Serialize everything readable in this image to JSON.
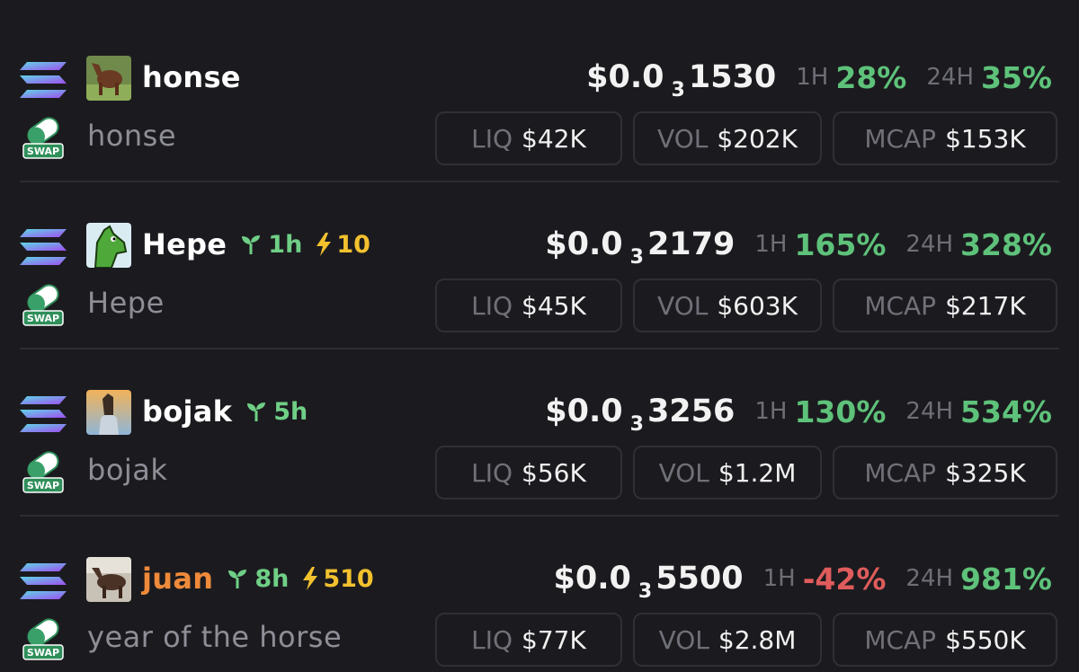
{
  "tokens": [
    {
      "symbol": "honse",
      "name": "honse",
      "name_color": "#ffffff",
      "age": "",
      "boost": "",
      "price_prefix": "$0.0",
      "price_zeros": "3",
      "price_digits": "1530",
      "change_1h_label": "1H",
      "change_1h": "28%",
      "change_1h_positive": true,
      "change_24h_label": "24H",
      "change_24h": "35%",
      "change_24h_positive": true,
      "liq_label": "LIQ",
      "liq": "$42K",
      "vol_label": "VOL",
      "vol": "$202K",
      "mcap_label": "MCAP",
      "mcap": "$153K",
      "avatar_icon": "horse-photo-avatar"
    },
    {
      "symbol": "Hepe",
      "name": "Hepe",
      "name_color": "#ffffff",
      "age": "1h",
      "boost": "10",
      "price_prefix": "$0.0",
      "price_zeros": "3",
      "price_digits": "2179",
      "change_1h_label": "1H",
      "change_1h": "165%",
      "change_1h_positive": true,
      "change_24h_label": "24H",
      "change_24h": "328%",
      "change_24h_positive": true,
      "liq_label": "LIQ",
      "liq": "$45K",
      "vol_label": "VOL",
      "vol": "$603K",
      "mcap_label": "MCAP",
      "mcap": "$217K",
      "avatar_icon": "green-horse-avatar"
    },
    {
      "symbol": "bojak",
      "name": "bojak",
      "name_color": "#ffffff",
      "age": "5h",
      "boost": "",
      "price_prefix": "$0.0",
      "price_zeros": "3",
      "price_digits": "3256",
      "change_1h_label": "1H",
      "change_1h": "130%",
      "change_1h_positive": true,
      "change_24h_label": "24H",
      "change_24h": "534%",
      "change_24h_positive": true,
      "liq_label": "LIQ",
      "liq": "$56K",
      "vol_label": "VOL",
      "vol": "$1.2M",
      "mcap_label": "MCAP",
      "mcap": "$325K",
      "avatar_icon": "horse-man-avatar"
    },
    {
      "symbol": "juan",
      "name": "year of the horse",
      "name_color": "#ee8a3a",
      "age": "8h",
      "boost": "510",
      "price_prefix": "$0.0",
      "price_zeros": "3",
      "price_digits": "5500",
      "change_1h_label": "1H",
      "change_1h": "-42%",
      "change_1h_positive": false,
      "change_24h_label": "24H",
      "change_24h": "981%",
      "change_24h_positive": true,
      "liq_label": "LIQ",
      "liq": "$77K",
      "vol_label": "VOL",
      "vol": "$2.8M",
      "mcap_label": "MCAP",
      "mcap": "$550K",
      "avatar_icon": "horse-photo-avatar"
    }
  ],
  "swap_badge_label": "SWAP",
  "colors": {
    "background": "#1b1b1f",
    "positive": "#5ec27a",
    "negative": "#e05c5c",
    "age_green": "#6fcf86",
    "boost_yellow": "#f2c12e",
    "muted": "#8e8e96"
  }
}
